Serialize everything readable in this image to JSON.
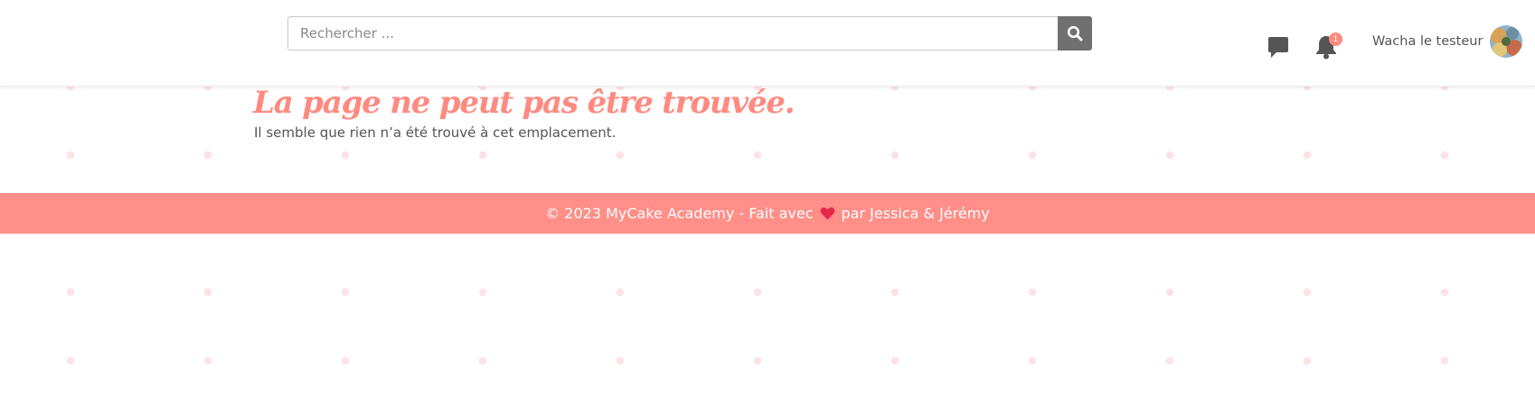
{
  "header": {
    "search": {
      "placeholder": "Rechercher ...",
      "value": ""
    },
    "icons": {
      "search": "search-icon",
      "messages": "chat-icon",
      "notifications": "bell-icon"
    },
    "notification_count": "1",
    "user": {
      "name": "Wacha le testeur"
    }
  },
  "main": {
    "title": "La page ne peut pas être trouvée.",
    "subtitle": "Il semble que rien n’a été trouvé à cet emplacement."
  },
  "footer": {
    "prefix": "© 2023 MyCake Academy - Fait avec",
    "suffix": "par Jessica & Jérémy",
    "heart_icon": "heart-icon"
  },
  "colors": {
    "accent": "#ff8a80",
    "footer_bg": "#ff8f88",
    "search_button": "#707070",
    "heart": "#e5294b",
    "icon": "#555555"
  }
}
